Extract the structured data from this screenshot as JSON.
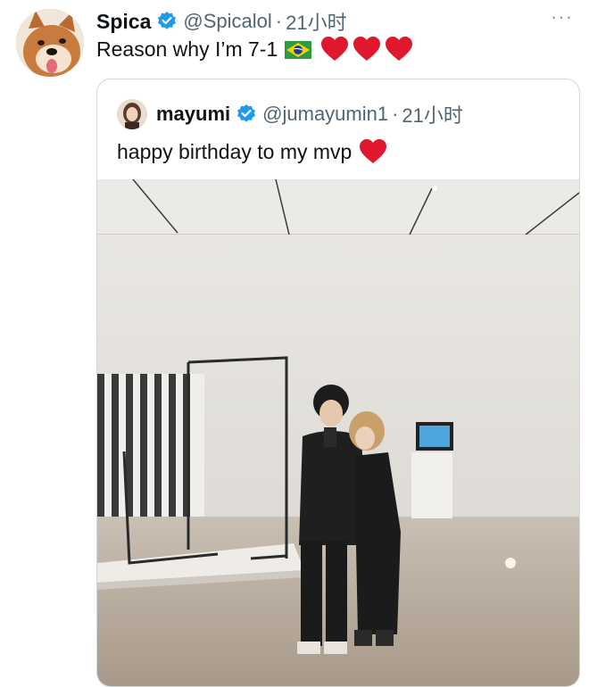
{
  "tweet": {
    "author_name": "Spica",
    "author_handle": "@Spicalol",
    "dot": "·",
    "time": "21小时",
    "text": "Reason why I’m 7-1",
    "more": "···",
    "icons": {
      "verified": "verified-badge-icon",
      "flag": "brazil-flag-icon",
      "heart": "red-heart-icon",
      "more": "more-icon"
    }
  },
  "quote": {
    "author_name": "mayumi",
    "author_handle": "@jumayumin1",
    "dot": "·",
    "time": "21小时",
    "text": "happy birthday to my mvp"
  },
  "colors": {
    "verified_blue": "#1d9bf0",
    "heart_red": "#e0182d",
    "secondary_text": "#536471",
    "border": "#cfd9de"
  }
}
